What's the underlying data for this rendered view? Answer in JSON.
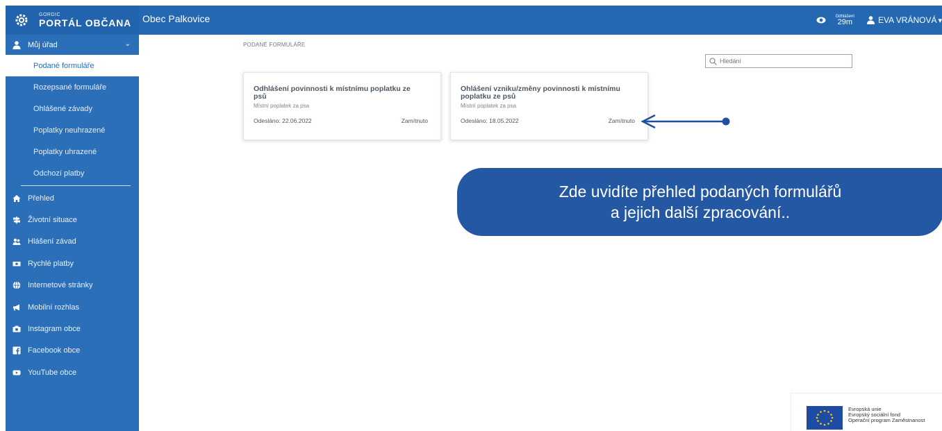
{
  "header": {
    "brand_small": "GORDIC",
    "brand_title": "PORTÁL OBČANA",
    "municipality": "Obec Palkovice",
    "session_label": "Odhlášení",
    "session_time": "29m",
    "user_name": "EVA VRÁNOVÁ",
    "user_caret": "▾"
  },
  "sidebar": {
    "section_label": "Můj úřad",
    "section_chevron": "⌄",
    "subitems": [
      {
        "label": "Podané formuláře",
        "active": true
      },
      {
        "label": "Rozepsané formuláře"
      },
      {
        "label": "Ohlášené závady"
      },
      {
        "label": "Poplatky neuhrazené"
      },
      {
        "label": "Poplatky uhrazené"
      },
      {
        "label": "Odchozí platby"
      }
    ],
    "items": [
      {
        "label": "Přehled",
        "icon": "home-icon"
      },
      {
        "label": "Životní situace",
        "icon": "signpost-icon"
      },
      {
        "label": "Hlášení závad",
        "icon": "people-icon"
      },
      {
        "label": "Rychlé platby",
        "icon": "money-icon"
      },
      {
        "label": "Internetové stránky",
        "icon": "globe-icon"
      },
      {
        "label": "Mobilní rozhlas",
        "icon": "megaphone-icon"
      },
      {
        "label": "Instagram obce",
        "icon": "camera-icon"
      },
      {
        "label": "Facebook obce",
        "icon": "facebook-icon"
      },
      {
        "label": "YouTube obce",
        "icon": "youtube-icon"
      }
    ]
  },
  "main": {
    "breadcrumb": "PODANÉ FORMULÁŘE",
    "search_placeholder": "Hledání",
    "cards": [
      {
        "title_line1": "Odhlášení povinnosti k místnímu poplatku ze",
        "title_line2": "psů",
        "subtitle": "Místní poplatek za psa",
        "sent": "Odesláno: 22.06.2022",
        "status": "Zamítnuto"
      },
      {
        "title_line1": "Ohlášení vzniku/změny povinnosti k místnímu",
        "title_line2": "poplatku ze psů",
        "subtitle": "Místní poplatek za psa",
        "sent": "Odesláno: 18.05.2022",
        "status": "Zamítnuto"
      }
    ]
  },
  "annotation": {
    "line1": "Zde uvidíte přehled podaných formulářů",
    "line2": "a jejich další zpracování.."
  },
  "eu_logo": {
    "line1": "Evropská unie",
    "line2": "Evropský sociální fond",
    "line3": "Operační program Zaměstnanost"
  },
  "colors": {
    "header_blue": "#2468b2",
    "sidebar_blue": "#2b6fb8",
    "callout_blue": "#2458a3",
    "arrow_blue": "#1f4fa0"
  }
}
